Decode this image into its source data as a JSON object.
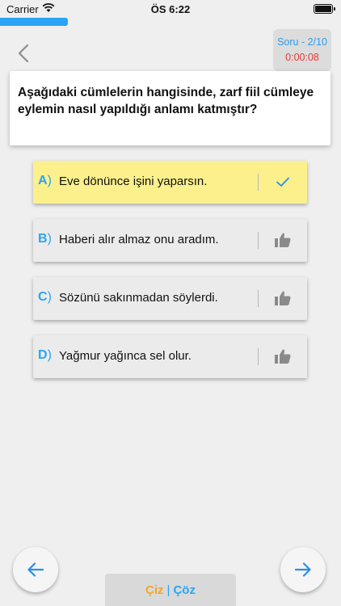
{
  "status_bar": {
    "carrier": "Carrier",
    "time": "ÖS 6:22"
  },
  "progress": {
    "fraction": 0.2,
    "color": "#2aa4f4"
  },
  "counter": {
    "question": "Soru - 2/10",
    "timer": "0:00:08"
  },
  "question": {
    "text": "Aşağıdaki cümlelerin hangisinde,  zarf fiil cümleye eylemin nasıl yapıldığı anlamı katmıştır?"
  },
  "options": [
    {
      "letter": "A",
      "paren": ")",
      "text": "Eve dönünce işini yaparsın.",
      "state": "selected",
      "icon": "check-icon"
    },
    {
      "letter": "B",
      "paren": ")",
      "text": "Haberi alır almaz onu aradım.",
      "state": "default",
      "icon": "thumbs-up-icon"
    },
    {
      "letter": "C",
      "paren": ")",
      "text": "Sözünü sakınmadan söylerdi.",
      "state": "default",
      "icon": "thumbs-up-icon"
    },
    {
      "letter": "D",
      "paren": ")",
      "text": "Yağmur yağınca sel olur.",
      "state": "default",
      "icon": "thumbs-up-icon"
    }
  ],
  "bottom": {
    "draw_label": "Çiz",
    "separator": "|",
    "solve_label": "Çöz"
  },
  "colors": {
    "accent": "#2aa4f4",
    "selected": "#fbf08c",
    "timer": "#e53935",
    "draw": "#f5a623"
  }
}
